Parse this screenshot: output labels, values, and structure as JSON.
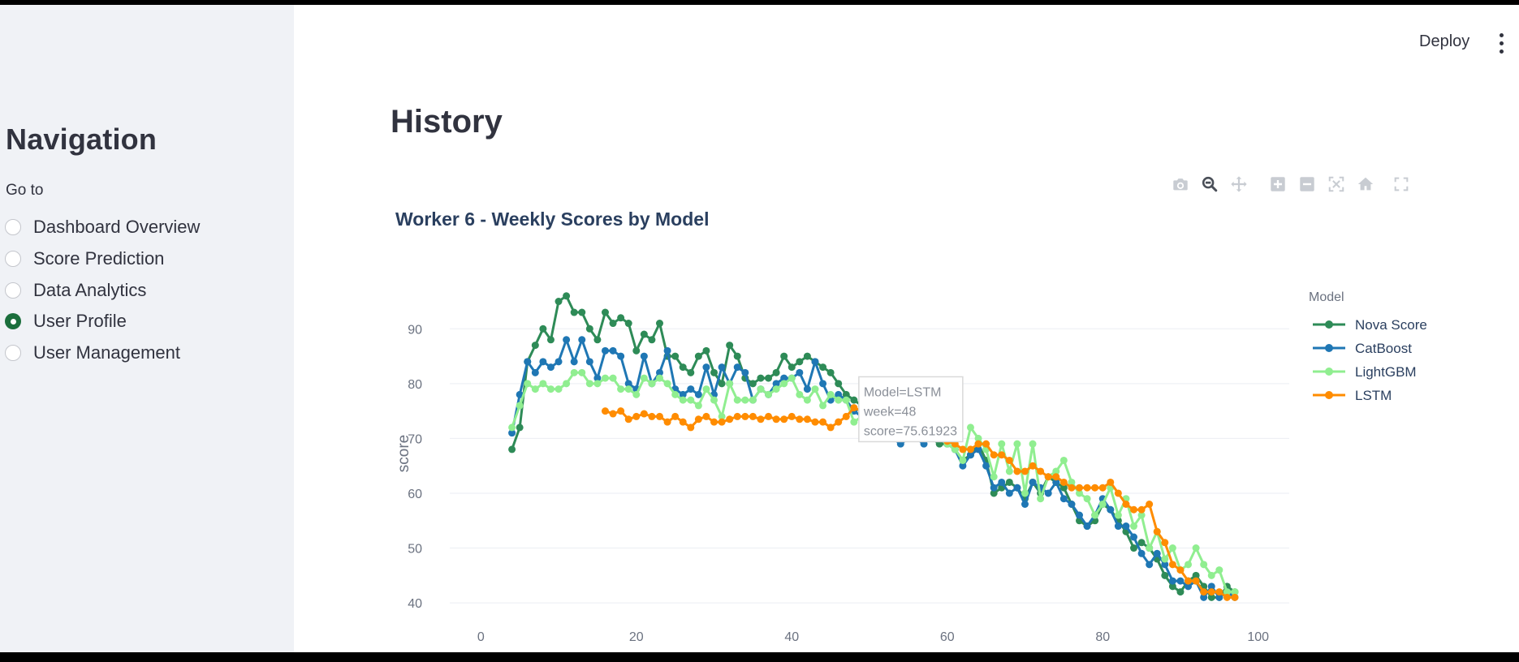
{
  "sidebar": {
    "title": "Navigation",
    "radio_label": "Go to",
    "options": [
      "Dashboard Overview",
      "Score Prediction",
      "Data Analytics",
      "User Profile",
      "User Management"
    ],
    "selected": "User Profile"
  },
  "header": {
    "deploy_label": "Deploy"
  },
  "main": {
    "title": "History"
  },
  "colors": {
    "accent": "#1b6e3c",
    "sidebar_bg": "#f0f2f6"
  },
  "icons": {
    "modebar": [
      "camera-icon",
      "zoom-icon",
      "pan-icon",
      "zoom-in-icon",
      "zoom-out-icon",
      "autoscale-icon",
      "reset-axes-icon",
      "fullscreen-icon"
    ],
    "menu": "kebab-menu-icon"
  },
  "chart_data": {
    "type": "line",
    "title": "Worker 6 - Weekly Scores by Model",
    "xlabel": "",
    "ylabel": "score",
    "xlim": [
      -4,
      104
    ],
    "ylim": [
      37.5,
      97
    ],
    "xticks": [
      0,
      20,
      40,
      60,
      80,
      100
    ],
    "yticks": [
      40,
      50,
      60,
      70,
      80,
      90
    ],
    "legend_title": "Model",
    "legend_position": "right",
    "grid": true,
    "series": [
      {
        "name": "Nova Score",
        "color": "#2e8b57",
        "x": [
          4,
          5,
          6,
          7,
          8,
          9,
          10,
          11,
          12,
          13,
          14,
          15,
          16,
          17,
          18,
          19,
          20,
          21,
          22,
          23,
          24,
          25,
          26,
          27,
          28,
          29,
          30,
          31,
          32,
          33,
          34,
          35,
          36,
          37,
          38,
          39,
          40,
          41,
          42,
          43,
          44,
          45,
          46,
          47,
          48,
          49,
          50,
          51,
          52,
          53,
          54,
          55,
          56,
          57,
          58,
          59,
          60,
          61,
          62,
          63,
          64,
          65,
          66,
          67,
          68,
          69,
          70,
          71,
          72,
          73,
          74,
          75,
          76,
          77,
          78,
          79,
          80,
          81,
          82,
          83,
          84,
          85,
          86,
          87,
          88,
          89,
          90,
          91,
          92,
          93,
          94,
          95,
          96,
          97
        ],
        "values": [
          68,
          72,
          84,
          87,
          90,
          88,
          95,
          96,
          93,
          93,
          90,
          88,
          93,
          91,
          92,
          91,
          86,
          89,
          88,
          91,
          85,
          85,
          83,
          82,
          85,
          86,
          82,
          80,
          87,
          85,
          81,
          80,
          81,
          81,
          82,
          85,
          83,
          84,
          85,
          84,
          83,
          82,
          80,
          78,
          77,
          76,
          75,
          74,
          73,
          72,
          72,
          71,
          71,
          70,
          70,
          69,
          69,
          68,
          66,
          67,
          69,
          66,
          60,
          61,
          62,
          61,
          59,
          62,
          60,
          63,
          62,
          61,
          58,
          55,
          54,
          55,
          58,
          57,
          55,
          53,
          50,
          51,
          50,
          48,
          45,
          43,
          42,
          44,
          45,
          43,
          41,
          41,
          43,
          42
        ]
      },
      {
        "name": "CatBoost",
        "color": "#1f77b4",
        "x": [
          4,
          5,
          6,
          7,
          8,
          9,
          10,
          11,
          12,
          13,
          14,
          15,
          16,
          17,
          18,
          19,
          20,
          21,
          22,
          23,
          24,
          25,
          26,
          27,
          28,
          29,
          30,
          31,
          32,
          33,
          34,
          35,
          36,
          37,
          38,
          39,
          40,
          41,
          42,
          43,
          44,
          45,
          46,
          47,
          48,
          49,
          50,
          51,
          52,
          53,
          54,
          55,
          56,
          57,
          58,
          59,
          60,
          61,
          62,
          63,
          64,
          65,
          66,
          67,
          68,
          69,
          70,
          71,
          72,
          73,
          74,
          75,
          76,
          77,
          78,
          79,
          80,
          81,
          82,
          83,
          84,
          85,
          86,
          87,
          88,
          89,
          90,
          91,
          92,
          93,
          94,
          95,
          96,
          97
        ],
        "values": [
          71,
          78,
          84,
          82,
          84,
          83,
          84,
          88,
          84,
          88,
          84,
          81,
          86,
          86,
          85,
          80,
          79,
          85,
          80,
          82,
          86,
          79,
          78,
          79,
          78,
          83,
          78,
          83,
          80,
          83,
          82,
          77,
          79,
          78,
          80,
          81,
          81,
          82,
          79,
          84,
          80,
          77,
          78,
          77,
          75,
          74,
          73,
          72,
          71,
          70,
          69,
          70,
          70,
          69,
          71,
          70,
          69,
          68,
          65,
          67,
          68,
          65,
          61,
          62,
          60,
          61,
          58,
          62,
          61,
          60,
          62,
          59,
          58,
          56,
          54,
          56,
          59,
          57,
          54,
          54,
          52,
          49,
          47,
          49,
          47,
          44,
          44,
          43,
          44,
          41,
          43,
          41,
          42,
          41
        ]
      },
      {
        "name": "LightGBM",
        "color": "#90ee90",
        "x": [
          4,
          5,
          6,
          7,
          8,
          9,
          10,
          11,
          12,
          13,
          14,
          15,
          16,
          17,
          18,
          19,
          20,
          21,
          22,
          23,
          24,
          25,
          26,
          27,
          28,
          29,
          30,
          31,
          32,
          33,
          34,
          35,
          36,
          37,
          38,
          39,
          40,
          41,
          42,
          43,
          44,
          45,
          46,
          47,
          48,
          49,
          50,
          51,
          52,
          53,
          54,
          55,
          56,
          57,
          58,
          59,
          60,
          61,
          62,
          63,
          64,
          65,
          66,
          67,
          68,
          69,
          70,
          71,
          72,
          73,
          74,
          75,
          76,
          77,
          78,
          79,
          80,
          81,
          82,
          83,
          84,
          85,
          86,
          87,
          88,
          89,
          90,
          91,
          92,
          93,
          94,
          95,
          96,
          97
        ],
        "values": [
          72,
          76,
          80,
          79,
          80,
          79,
          79,
          80,
          82,
          82,
          80,
          80,
          81,
          81,
          79,
          79,
          78,
          81,
          80,
          81,
          80,
          78,
          77,
          77,
          76,
          79,
          77,
          74,
          80,
          77,
          77,
          77,
          79,
          78,
          79,
          80,
          81,
          78,
          77,
          79,
          76,
          78,
          77,
          77,
          73,
          74,
          74,
          73,
          72,
          71,
          71,
          70,
          70,
          70,
          70,
          70,
          69,
          68,
          66,
          72,
          70,
          68,
          63,
          69,
          64,
          69,
          60,
          69,
          59,
          63,
          64,
          66,
          62,
          60,
          59,
          56,
          58,
          61,
          56,
          59,
          54,
          56,
          50,
          53,
          48,
          50,
          46,
          47,
          50,
          47,
          45,
          46,
          42,
          42
        ]
      },
      {
        "name": "LSTM",
        "color": "#ff8c00",
        "x": [
          16,
          17,
          18,
          19,
          20,
          21,
          22,
          23,
          24,
          25,
          26,
          27,
          28,
          29,
          30,
          31,
          32,
          33,
          34,
          35,
          36,
          37,
          38,
          39,
          40,
          41,
          42,
          43,
          44,
          45,
          46,
          47,
          48,
          49,
          50,
          51,
          52,
          53,
          54,
          55,
          56,
          57,
          58,
          59,
          60,
          61,
          62,
          63,
          64,
          65,
          66,
          67,
          68,
          69,
          70,
          71,
          72,
          73,
          74,
          75,
          76,
          77,
          78,
          79,
          80,
          81,
          82,
          83,
          84,
          85,
          86,
          87,
          88,
          89,
          90,
          91,
          92,
          93,
          94,
          95,
          96,
          97
        ],
        "values": [
          75,
          74.5,
          75,
          73.5,
          74,
          74.5,
          74,
          74,
          73,
          74,
          73,
          72,
          73.5,
          74,
          73,
          73,
          73.5,
          74,
          74,
          74,
          73.5,
          74,
          73.5,
          73.5,
          74,
          73.5,
          73.5,
          73,
          73,
          72,
          73,
          74,
          75.6,
          75,
          74,
          73.5,
          73,
          72.5,
          72,
          71.5,
          71,
          70.5,
          70,
          70,
          69.5,
          69,
          68,
          68,
          69,
          69,
          67,
          67,
          66,
          64,
          64,
          65,
          64,
          63,
          63,
          62,
          61,
          61,
          61,
          61,
          61,
          62,
          60,
          58,
          57,
          57,
          58,
          53,
          51,
          47,
          46,
          44,
          44,
          42,
          42,
          42,
          41,
          41
        ]
      }
    ],
    "tooltip": {
      "line1": "Model=LSTM",
      "line2": "week=48",
      "line3": "score=75.61923",
      "x": 48,
      "y": 75.61923
    }
  }
}
